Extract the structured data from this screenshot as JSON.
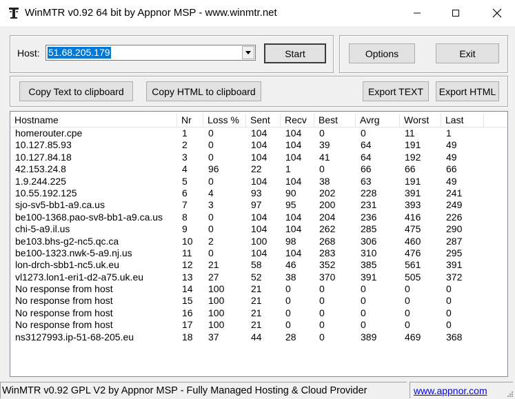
{
  "window": {
    "title": "WinMTR v0.92 64 bit by Appnor MSP - www.winmtr.net"
  },
  "host": {
    "label": "Host:",
    "value": "51.68.205.179"
  },
  "buttons": {
    "start": "Start",
    "options": "Options",
    "exit": "Exit",
    "copy_text": "Copy Text to clipboard",
    "copy_html": "Copy HTML to clipboard",
    "export_text": "Export TEXT",
    "export_html": "Export HTML"
  },
  "table": {
    "columns": [
      "Hostname",
      "Nr",
      "Loss %",
      "Sent",
      "Recv",
      "Best",
      "Avrg",
      "Worst",
      "Last"
    ],
    "rows": [
      [
        "homerouter.cpe",
        "1",
        "0",
        "104",
        "104",
        "0",
        "0",
        "11",
        "1"
      ],
      [
        "10.127.85.93",
        "2",
        "0",
        "104",
        "104",
        "39",
        "64",
        "191",
        "49"
      ],
      [
        "10.127.84.18",
        "3",
        "0",
        "104",
        "104",
        "41",
        "64",
        "192",
        "49"
      ],
      [
        "42.153.24.8",
        "4",
        "96",
        "22",
        "1",
        "0",
        "66",
        "66",
        "66"
      ],
      [
        "1.9.244.225",
        "5",
        "0",
        "104",
        "104",
        "38",
        "63",
        "191",
        "49"
      ],
      [
        "10.55.192.125",
        "6",
        "4",
        "93",
        "90",
        "202",
        "228",
        "391",
        "241"
      ],
      [
        "sjo-sv5-bb1-a9.ca.us",
        "7",
        "3",
        "97",
        "95",
        "200",
        "231",
        "393",
        "249"
      ],
      [
        "be100-1368.pao-sv8-bb1-a9.ca.us",
        "8",
        "0",
        "104",
        "104",
        "204",
        "236",
        "416",
        "226"
      ],
      [
        "chi-5-a9.il.us",
        "9",
        "0",
        "104",
        "104",
        "262",
        "285",
        "475",
        "290"
      ],
      [
        "be103.bhs-g2-nc5.qc.ca",
        "10",
        "2",
        "100",
        "98",
        "268",
        "306",
        "460",
        "287"
      ],
      [
        "be100-1323.nwk-5-a9.nj.us",
        "11",
        "0",
        "104",
        "104",
        "283",
        "310",
        "476",
        "295"
      ],
      [
        "lon-drch-sbb1-nc5.uk.eu",
        "12",
        "21",
        "58",
        "46",
        "352",
        "385",
        "561",
        "391"
      ],
      [
        "vl1273.lon1-eri1-d2-a75.uk.eu",
        "13",
        "27",
        "52",
        "38",
        "370",
        "391",
        "505",
        "372"
      ],
      [
        "No response from host",
        "14",
        "100",
        "21",
        "0",
        "0",
        "0",
        "0",
        "0"
      ],
      [
        "No response from host",
        "15",
        "100",
        "21",
        "0",
        "0",
        "0",
        "0",
        "0"
      ],
      [
        "No response from host",
        "16",
        "100",
        "21",
        "0",
        "0",
        "0",
        "0",
        "0"
      ],
      [
        "No response from host",
        "17",
        "100",
        "21",
        "0",
        "0",
        "0",
        "0",
        "0"
      ],
      [
        "ns3127993.ip-51-68-205.eu",
        "18",
        "37",
        "44",
        "28",
        "0",
        "389",
        "469",
        "368"
      ]
    ]
  },
  "status": {
    "left": "WinMTR v0.92 GPL V2 by Appnor MSP - Fully Managed Hosting & Cloud Provider",
    "link": "www.appnor.com"
  },
  "icons": {
    "app": "terminal-tower-icon",
    "minimize": "minimize-icon",
    "maximize": "maximize-icon",
    "close": "close-icon",
    "dropdown": "chevron-down-icon",
    "grip": "resize-grip-icon"
  },
  "colors": {
    "selection": "#0078d7",
    "link": "#0000ee",
    "window_bg": "#f0f0f0"
  }
}
